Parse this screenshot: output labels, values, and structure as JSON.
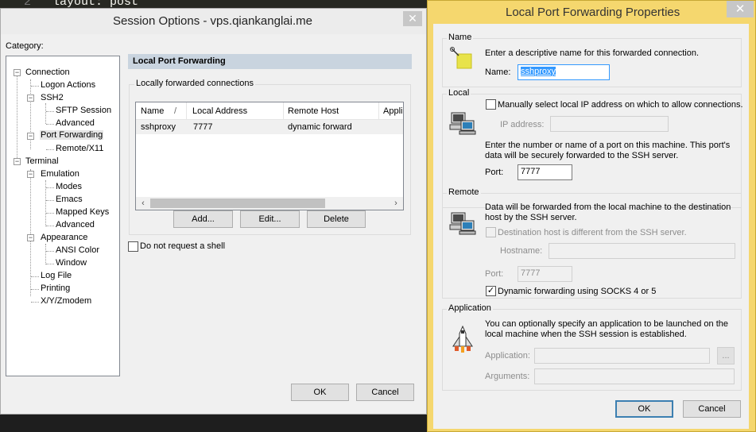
{
  "background": {
    "line_number": "2",
    "code": "layout: post"
  },
  "session_options": {
    "title": "Session Options - vps.qiankanglai.me",
    "category_label": "Category:",
    "tree": [
      {
        "label": "Connection",
        "level": 0
      },
      {
        "label": "Logon Actions",
        "level": 1
      },
      {
        "label": "SSH2",
        "level": 1
      },
      {
        "label": "SFTP Session",
        "level": 2
      },
      {
        "label": "Advanced",
        "level": 2
      },
      {
        "label": "Port Forwarding",
        "level": 1
      },
      {
        "label": "Remote/X11",
        "level": 2
      },
      {
        "label": "Terminal",
        "level": 0
      },
      {
        "label": "Emulation",
        "level": 1
      },
      {
        "label": "Modes",
        "level": 2
      },
      {
        "label": "Emacs",
        "level": 2
      },
      {
        "label": "Mapped Keys",
        "level": 2
      },
      {
        "label": "Advanced",
        "level": 2
      },
      {
        "label": "Appearance",
        "level": 1
      },
      {
        "label": "ANSI Color",
        "level": 2
      },
      {
        "label": "Window",
        "level": 2
      },
      {
        "label": "Log File",
        "level": 1
      },
      {
        "label": "Printing",
        "level": 1
      },
      {
        "label": "X/Y/Zmodem",
        "level": 1
      }
    ],
    "panel_header": "Local Port Forwarding",
    "group_label": "Locally forwarded connections",
    "columns": [
      "Name",
      "Local Address",
      "Remote Host",
      "Appli"
    ],
    "sort_indicator": "/",
    "rows": [
      {
        "name": "sshproxy",
        "local": "7777",
        "remote": "dynamic forward"
      }
    ],
    "buttons": {
      "add": "Add...",
      "edit": "Edit...",
      "delete": "Delete",
      "ok": "OK",
      "cancel": "Cancel"
    },
    "no_shell_label": "Do not request a shell"
  },
  "properties": {
    "title": "Local Port Forwarding Properties",
    "name_group": "Name",
    "name_desc": "Enter a descriptive name for this forwarded connection.",
    "name_label": "Name:",
    "name_value": "sshproxy",
    "local_group": "Local",
    "manual_ip_label": "Manually select local IP address on which to allow connections.",
    "ip_label": "IP address:",
    "port_desc_1": "Enter the number or name of a port on this machine.  This port's",
    "port_desc_2": "data will be securely forwarded to the SSH server.",
    "port_label": "Port:",
    "port_value": "7777",
    "remote_group": "Remote",
    "remote_desc_1": "Data will be forwarded from the local machine to the destination",
    "remote_desc_2": "host by the SSH server.",
    "dest_diff_label": "Destination host is different from the SSH server.",
    "hostname_label": "Hostname:",
    "remote_port_label": "Port:",
    "remote_port_value": "7777",
    "socks_label": "Dynamic forwarding using SOCKS 4 or 5",
    "socks_checked": true,
    "app_group": "Application",
    "app_desc_1": "You can optionally specify an application to be launched on the",
    "app_desc_2": "local machine when the SSH session is established.",
    "application_label": "Application:",
    "arguments_label": "Arguments:",
    "browse_label": "...",
    "ok": "OK",
    "cancel": "Cancel"
  }
}
